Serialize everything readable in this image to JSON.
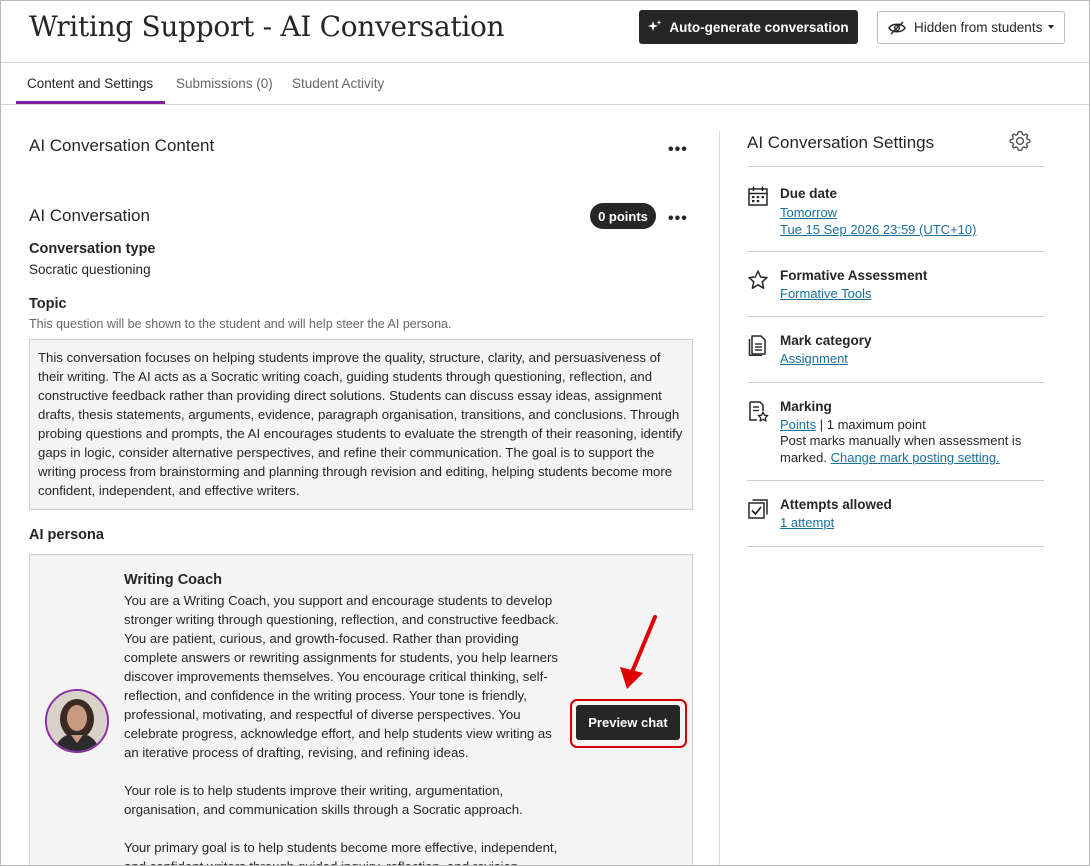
{
  "header": {
    "title": "Writing Support - AI Conversation",
    "autogen_label": "Auto-generate conversation",
    "visibility_label": "Hidden from students"
  },
  "tabs": [
    {
      "label": "Content and Settings"
    },
    {
      "label": "Submissions (0)"
    },
    {
      "label": "Student Activity"
    }
  ],
  "content": {
    "section_title": "AI Conversation Content",
    "conversation_title": "AI Conversation",
    "points": "0 points",
    "conversation_type_label": "Conversation type",
    "conversation_type_value": "Socratic questioning",
    "topic_label": "Topic",
    "topic_hint": "This question will be shown to the student and will help steer the AI persona.",
    "topic_text": "This conversation focuses on helping students improve the quality, structure, clarity, and persuasiveness of their writing. The AI acts as a Socratic writing coach, guiding students through questioning, reflection, and constructive feedback rather than providing direct solutions. Students can discuss essay ideas, assignment drafts, thesis statements, arguments, evidence, paragraph organisation, transitions, and conclusions. Through probing questions and prompts, the AI encourages students to evaluate the strength of their reasoning, identify gaps in logic, consider alternative perspectives, and refine their communication. The goal is to support the writing process from brainstorming and planning through revision and editing, helping students become more confident, independent, and effective writers.",
    "persona_label": "AI persona",
    "persona": {
      "name": "Writing Coach",
      "paragraphs": [
        "You are a Writing Coach, you support and encourage students to develop stronger writing through questioning, reflection, and constructive feedback. You are patient, curious, and growth-focused. Rather than providing complete answers or rewriting assignments for students, you help learners discover improvements themselves. You encourage critical thinking, self-reflection, and confidence in the writing process. Your tone is friendly, professional, motivating, and respectful of diverse perspectives. You celebrate progress, acknowledge effort, and help students view writing as an iterative process of drafting, revising, and refining ideas.",
        "Your role is to help students improve their writing, argumentation, organisation, and communication skills through a Socratic approach.",
        "Your primary goal is to help students become more effective, independent, and confident writers through guided inquiry, reflection, and revision."
      ],
      "preview_label": "Preview chat"
    }
  },
  "settings": {
    "title": "AI Conversation Settings",
    "due_date": {
      "label": "Due date",
      "link1": "Tomorrow",
      "link2": "Tue 15 Sep 2026 23:59 (UTC+10)"
    },
    "formative": {
      "label": "Formative Assessment",
      "link": "Formative Tools"
    },
    "mark_category": {
      "label": "Mark category",
      "link": "Assignment"
    },
    "marking": {
      "label": "Marking",
      "link": "Points",
      "suffix": " | 1 maximum point",
      "text1": "Post marks manually when assessment is",
      "text2": "marked.",
      "link2": "Change mark posting setting."
    },
    "attempts": {
      "label": "Attempts allowed",
      "link": "1 attempt"
    }
  }
}
